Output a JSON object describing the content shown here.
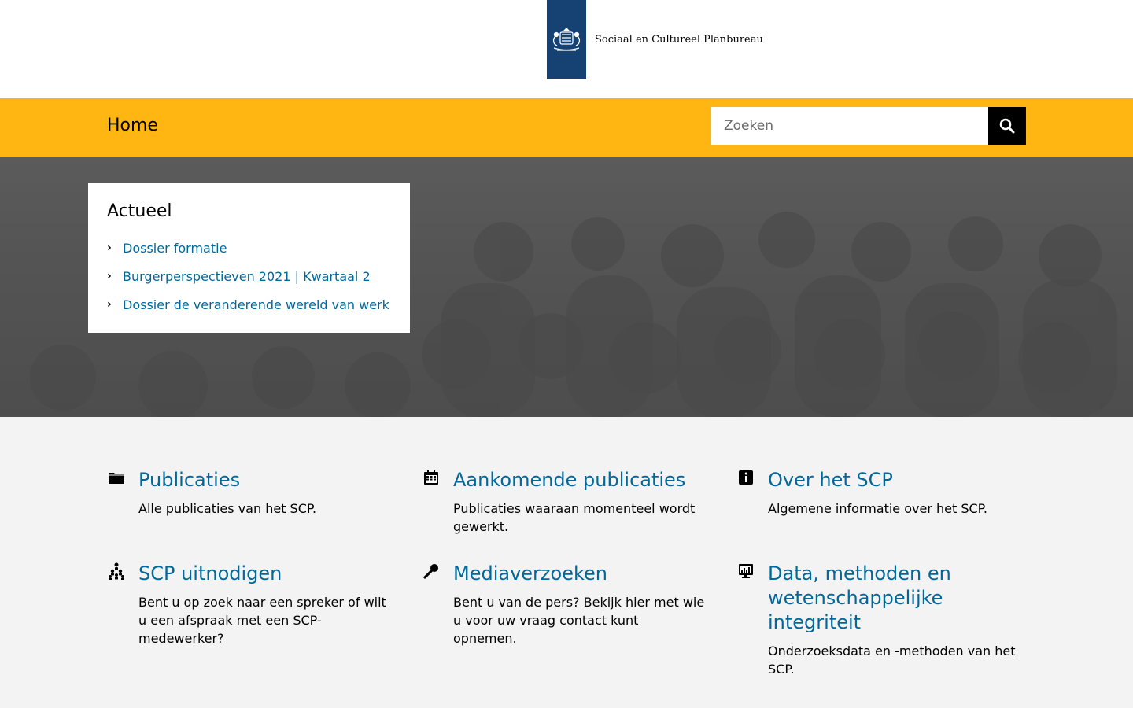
{
  "header": {
    "org_name": "Sociaal en Cultureel Planbureau",
    "brand_color": "#154273"
  },
  "nav": {
    "home_label": "Home",
    "bar_color": "#ffb612"
  },
  "search": {
    "placeholder": "Zoeken",
    "icon": "search-icon"
  },
  "actueel": {
    "title": "Actueel",
    "items": [
      {
        "label": "Dossier formatie"
      },
      {
        "label": "Burgerperspectieven 2021 | Kwartaal 2"
      },
      {
        "label": "Dossier de veranderende wereld van werk"
      }
    ]
  },
  "tiles": [
    {
      "icon": "folder-icon",
      "title": "Publicaties",
      "desc": "Alle publicaties van het SCP."
    },
    {
      "icon": "calendar-icon",
      "title": "Aankomende publicaties",
      "desc": "Publicaties waaraan momenteel wordt gewerkt."
    },
    {
      "icon": "info-icon",
      "title": "Over het SCP",
      "desc": "Algemene informatie over het SCP."
    },
    {
      "icon": "people-icon",
      "title": "SCP uitnodigen",
      "desc": "Bent u op zoek naar een spreker of wilt u een afspraak met een SCP-medewerker?"
    },
    {
      "icon": "microphone-icon",
      "title": "Mediaverzoeken",
      "desc": "Bent u van de pers? Bekijk hier met wie u voor uw vraag contact kunt opnemen."
    },
    {
      "icon": "data-monitor-icon",
      "title": "Data, methoden en wetenschappelijke integriteit",
      "desc": "Onderzoeksdata en -methoden van het SCP."
    }
  ],
  "colors": {
    "link": "#01689b",
    "page_bg": "#f3f3f3"
  }
}
